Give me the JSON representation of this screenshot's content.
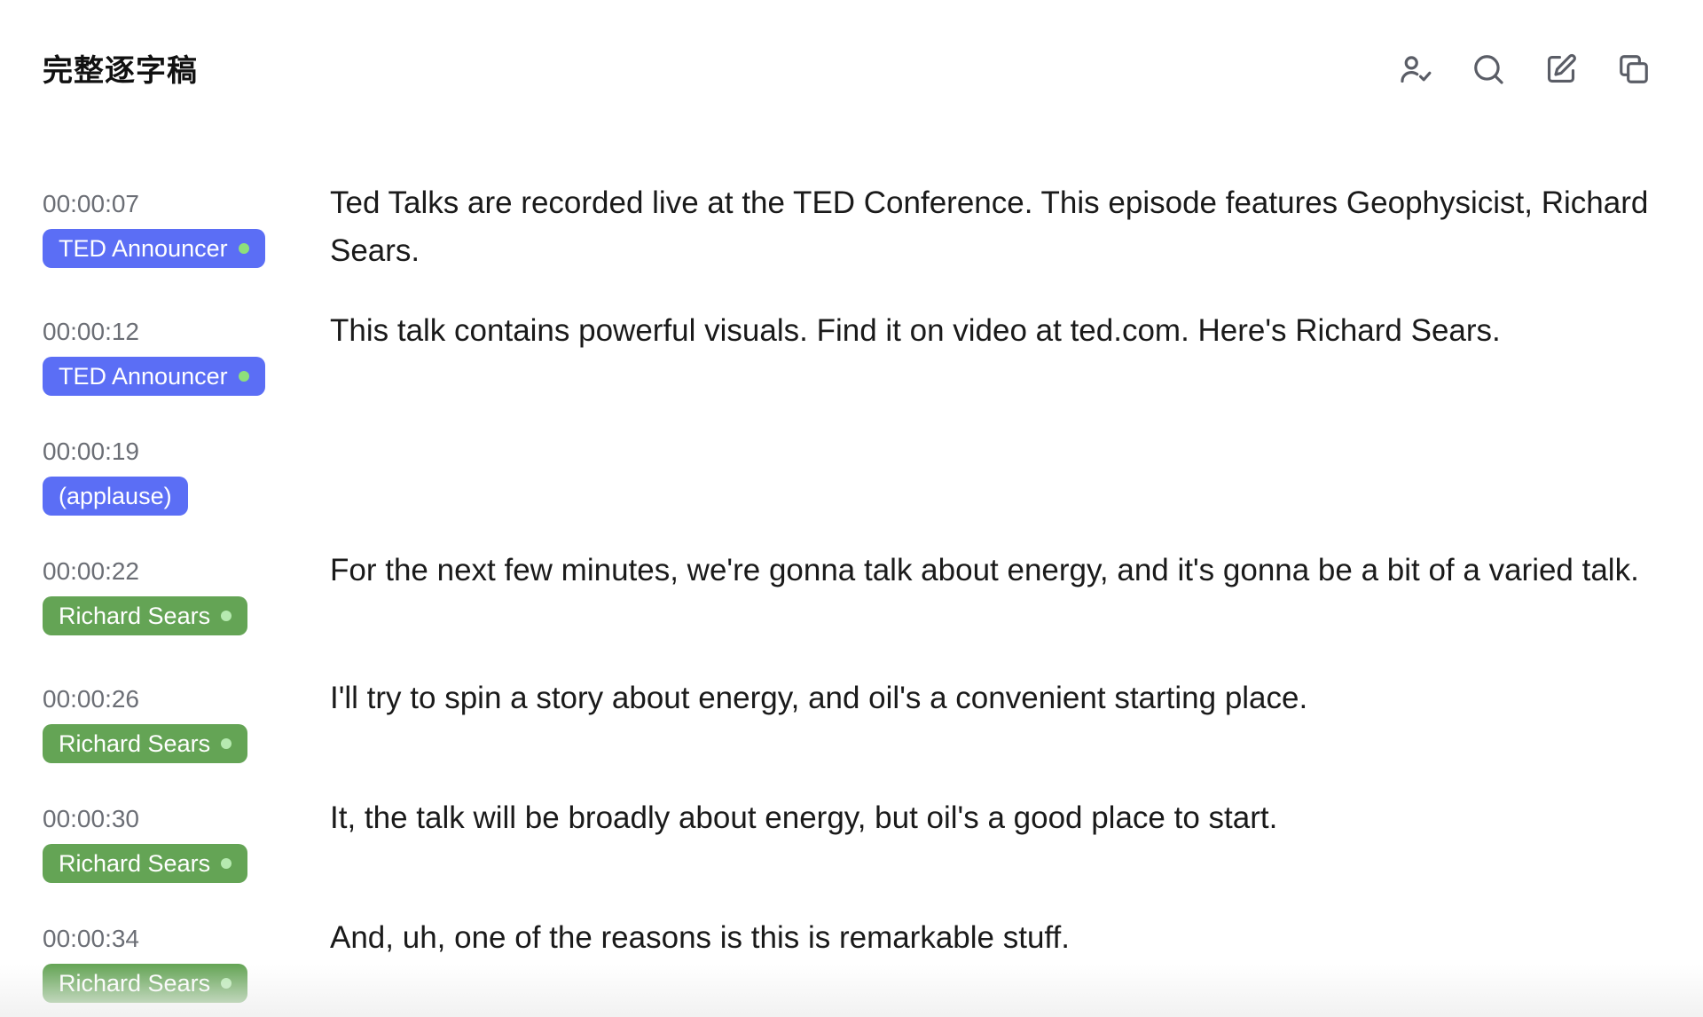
{
  "header": {
    "title": "完整逐字稿",
    "tools": [
      {
        "name": "speaker-check-icon"
      },
      {
        "name": "search-icon"
      },
      {
        "name": "edit-icon"
      },
      {
        "name": "copy-icon"
      }
    ]
  },
  "colors": {
    "announcer_badge": "#5b6ef5",
    "speaker_badge": "#64a455",
    "dot": "#8ee07b",
    "timestamp": "#6b6e75",
    "text": "#1a1a1a"
  },
  "segments": [
    {
      "time": "00:00:07",
      "speaker": "TED Announcer",
      "speaker_color": "blue",
      "has_dot": true,
      "text": "Ted Talks are recorded live at the TED Conference. This episode features Geophysicist, Richard Sears."
    },
    {
      "time": "00:00:12",
      "speaker": "TED Announcer",
      "speaker_color": "blue",
      "has_dot": true,
      "text": "This talk contains powerful visuals. Find it on video at ted.com. Here's Richard Sears."
    },
    {
      "time": "00:00:19",
      "speaker": "(applause)",
      "speaker_color": "blue",
      "has_dot": false,
      "text": ""
    },
    {
      "time": "00:00:22",
      "speaker": "Richard Sears",
      "speaker_color": "green",
      "has_dot": true,
      "text": "For the next few minutes, we're gonna talk about energy, and it's gonna be a bit of a varied talk."
    },
    {
      "time": "00:00:26",
      "speaker": "Richard Sears",
      "speaker_color": "green",
      "has_dot": true,
      "text": "I'll try to spin a story about energy, and oil's a convenient starting place."
    },
    {
      "time": "00:00:30",
      "speaker": "Richard Sears",
      "speaker_color": "green",
      "has_dot": true,
      "text": "It, the talk will be broadly about energy, but oil's a good place to start."
    },
    {
      "time": "00:00:34",
      "speaker": "Richard Sears",
      "speaker_color": "green",
      "has_dot": true,
      "text": "And, uh, one of the reasons is this is remarkable stuff."
    }
  ]
}
